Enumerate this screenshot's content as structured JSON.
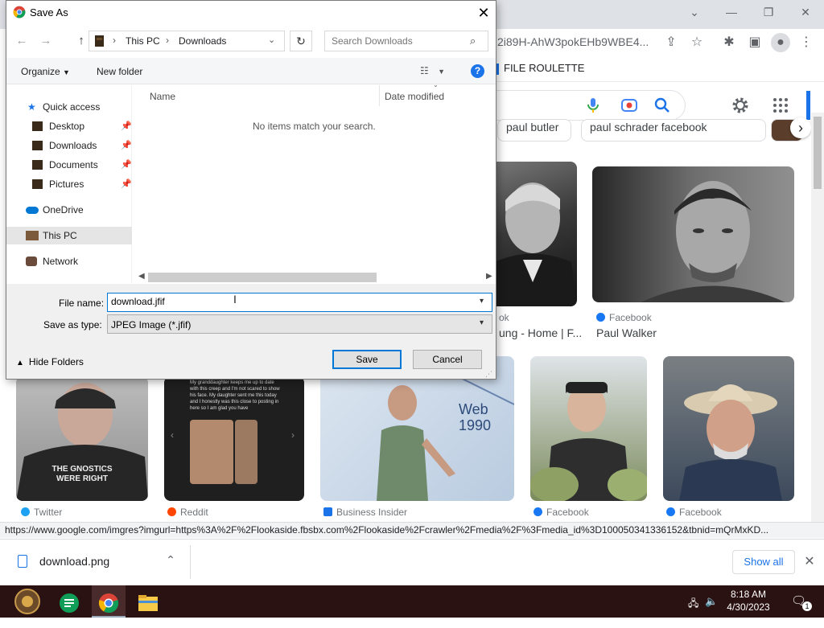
{
  "browser": {
    "url_fragment": "2i89H-AhW3pokEHb9WBE4...",
    "bookmark": "FILE ROULETTE",
    "chips": [
      "paul butler",
      "paul schrader facebook"
    ],
    "status_url": "https://www.google.com/imgres?imgurl=https%3A%2F%2Flookaside.fbsbx.com%2Flookaside%2Fcrawler%2Fmedia%2F%3Fmedia_id%3D100050341336152&tbnid=mQrMxKD...",
    "results": {
      "r1_source": "ok",
      "r1_title": "ung - Home | F...",
      "r2_source": "Facebook",
      "r2_title": "Paul Walker",
      "row2": [
        {
          "source": "Twitter",
          "color": "#1da1f2"
        },
        {
          "source": "Reddit",
          "color": "#ff4500"
        },
        {
          "source": "Business Insider",
          "color": "#1a73e8"
        },
        {
          "source": "Facebook",
          "color": "#1877f2"
        },
        {
          "source": "Facebook",
          "color": "#1877f2"
        }
      ]
    },
    "meme_text": "My granddaughter keeps me up to date with this creep and I'm not scared to show his face. My daughter sent me this today and I honestly was this close to posting in here so I am glad you have",
    "shirt_text": "THE GNOSTICS WERE RIGHT",
    "slide_text": "Web 1990"
  },
  "download_shelf": {
    "file_name": "download.png",
    "show_all": "Show all"
  },
  "taskbar": {
    "time": "8:18 AM",
    "date": "4/30/2023",
    "notification_count": "1"
  },
  "dialog": {
    "title": "Save As",
    "path": [
      "This PC",
      "Downloads"
    ],
    "search_placeholder": "Search Downloads",
    "organize": "Organize",
    "new_folder": "New folder",
    "nav": {
      "quick_access": "Quick access",
      "items": [
        "Desktop",
        "Downloads",
        "Documents",
        "Pictures"
      ],
      "onedrive": "OneDrive",
      "this_pc": "This PC",
      "network": "Network"
    },
    "columns": {
      "name": "Name",
      "date_modified": "Date modified"
    },
    "empty_message": "No items match your search.",
    "file_name_label": "File name:",
    "file_name_value": "download.jfif",
    "save_as_type_label": "Save as type:",
    "save_as_type_value": "JPEG Image (*.jfif)",
    "hide_folders": "Hide Folders",
    "save": "Save",
    "cancel": "Cancel"
  }
}
